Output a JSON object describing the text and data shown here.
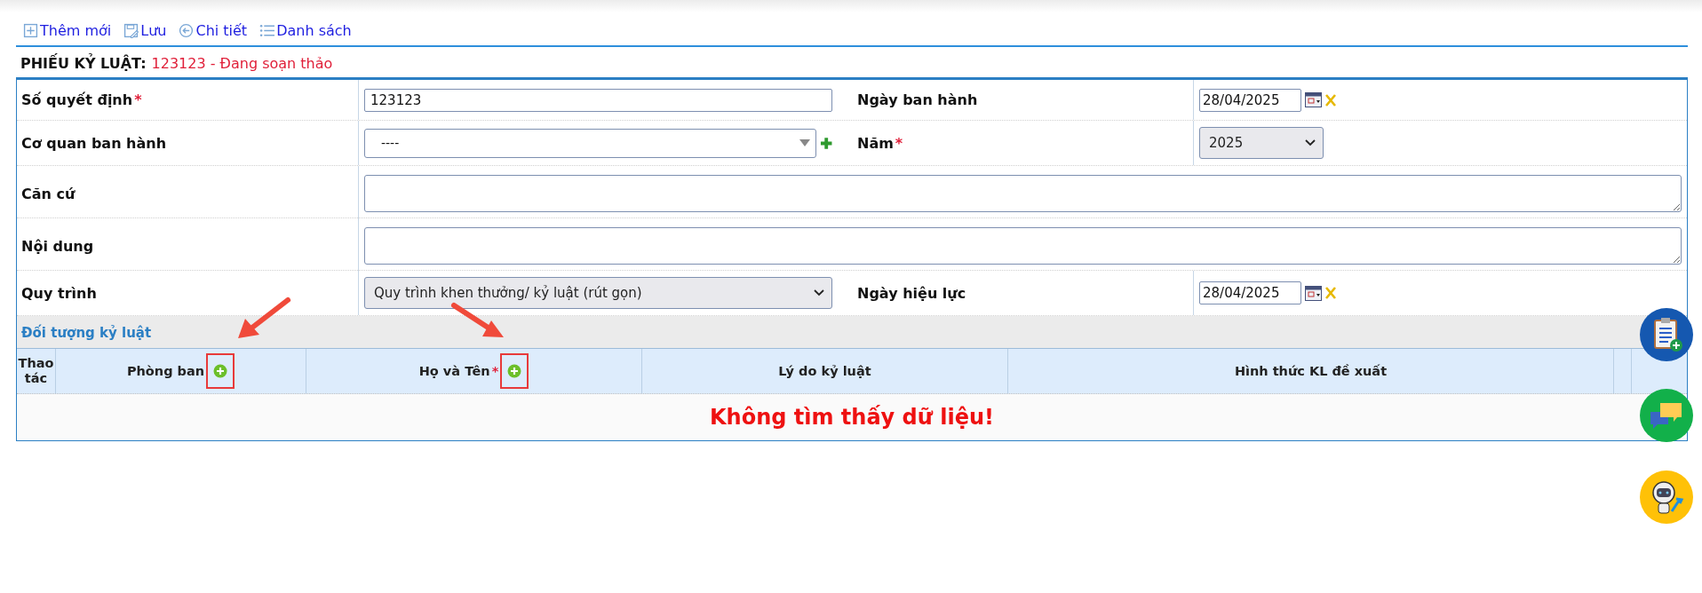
{
  "toolbar": [
    {
      "kind": "add",
      "label": "Thêm mới"
    },
    {
      "kind": "save",
      "label": "Lưu"
    },
    {
      "kind": "back",
      "label": "Chi tiết"
    },
    {
      "kind": "list",
      "label": "Danh sách"
    }
  ],
  "header": {
    "title": "PHIẾU KỶ LUẬT:",
    "status": "123123 - Đang soạn thảo"
  },
  "rows": [
    {
      "cells": [
        {
          "kind": "text",
          "label": "Số quyết định",
          "required_mark": "*",
          "value": "123123"
        },
        {
          "kind": "date",
          "label": "Ngày ban hành",
          "value": "28/04/2025"
        }
      ]
    },
    {
      "cells": [
        {
          "kind": "combo",
          "label": "Cơ quan ban hành",
          "value": "----"
        },
        {
          "kind": "select",
          "label": "Năm",
          "required_mark": "*",
          "value": "2025"
        }
      ]
    },
    {
      "cells": [
        {
          "kind": "textarea",
          "label": "Căn cứ"
        }
      ]
    },
    {
      "cells": [
        {
          "kind": "textarea",
          "label": "Nội dung"
        }
      ]
    },
    {
      "cells": [
        {
          "kind": "select",
          "label": "Quy trình",
          "value": "Quy trình khen thưởng/ kỷ luật (rút gọn)"
        },
        {
          "kind": "date",
          "label": "Ngày hiệu lực",
          "value": "28/04/2025"
        }
      ]
    }
  ],
  "section": {
    "title": "Đối tượng kỷ luật",
    "columns": [
      {
        "label": "Thao tác"
      },
      {
        "label": "Phòng ban",
        "add": true,
        "highlighted": true,
        "annotation": {
          "kind": "arrow-down-left"
        }
      },
      {
        "label": "Họ và Tên",
        "required_mark": "*",
        "add": true,
        "highlighted": true,
        "annotation": {
          "kind": "arrow-down-right"
        }
      },
      {
        "label": "Lý do kỷ luật"
      },
      {
        "label": "Hình thức KL đề xuất"
      }
    ],
    "empty_message": "Không tìm thấy dữ liệu!"
  }
}
